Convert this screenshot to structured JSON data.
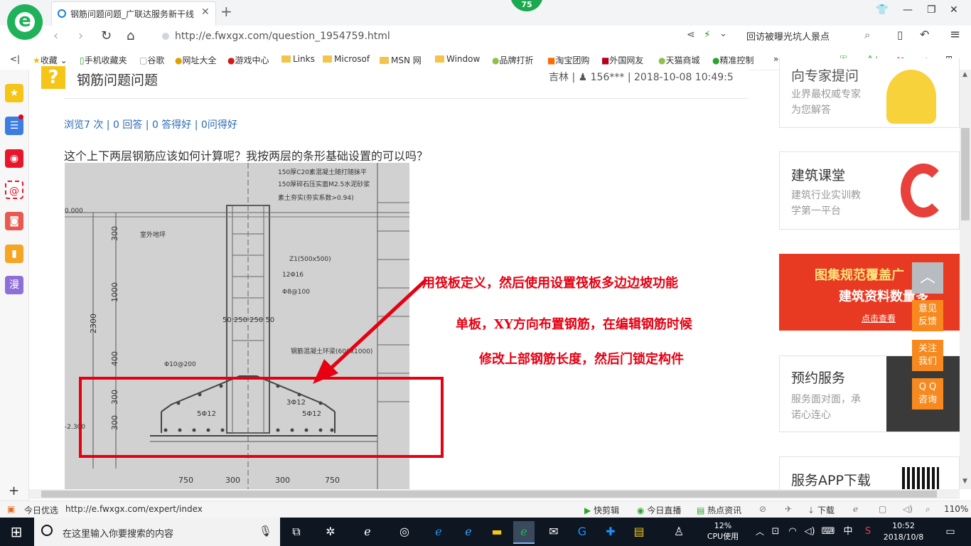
{
  "browser": {
    "tab_title": "钢筋问题问题_广联达服务新干线",
    "badge": "75",
    "url": "http://e.fwxgx.com/question_1954759.html",
    "search_text": "回访被曝光坑人景点"
  },
  "bookmarks": [
    "收藏",
    "手机收藏夹",
    "谷歌",
    "网址大全",
    "游戏中心",
    "Links",
    "Microsof",
    "MSN 网",
    "Window",
    "品牌打折",
    "淘宝团购",
    "外国网友",
    "天猫商城",
    "精准控制"
  ],
  "question": {
    "title": "钢筋问题问题",
    "author": "吉林",
    "user": "156***",
    "datetime": "2018-10-08 10:49:5",
    "stats": "浏览7 次 | 0 回答 | 0 答得好 | 0问得好",
    "text": "这个上下两层钢筋应该如何计算呢？我按两层的条形基础设置的可以吗？"
  },
  "annotation": {
    "line1": "用筏板定义，然后使用设置筏板多边边坡功能",
    "line2": "单板，XY方向布置钢筋，在编辑钢筋时候",
    "line3": "修改上部钢筋长度，然后门锁定构件"
  },
  "photo_labels": {
    "l1": "150厚C20素混凝土随打随抹平",
    "l2": "150厚碎石压实面M2.5水泥砂浆",
    "l3": "素土夯实(夯实系数>0.94)",
    "zi": "Z1(500x500)",
    "r1": "12Φ16",
    "r2": "Φ8@100",
    "d1": "50 250 250 50",
    "d2": "Φ10@200",
    "d3": "钢筋混凝土环梁(600x1000)",
    "b1": "5Φ12",
    "b2": "3Φ12",
    "b3": "5Φ12",
    "y1": "300",
    "y2": "1000",
    "y3": "2300",
    "y4": "400",
    "y5": "300",
    "y6": "300",
    "x1": "750",
    "x2": "300",
    "x3": "300",
    "x4": "750",
    "lvl": "-2.300",
    "top": "0.000",
    "room": "室外地坪"
  },
  "sidebar_right": {
    "card1_title": "向专家提问",
    "card1_sub1": "业界最权威专家",
    "card1_sub2": "为您解答",
    "card2_title": "建筑课堂",
    "card2_sub1": "建筑行业实训教",
    "card2_sub2": "学第一平台",
    "banner_line1": "图集规范覆盖广",
    "banner_line2": "建筑资料数量多",
    "banner_btn": "点击查看",
    "card3_title": "预约服务",
    "card3_sub1": "服务面对面，承",
    "card3_sub2": "诺心连心",
    "card4_title": "服务APP下载",
    "float1a": "意见",
    "float1b": "反馈",
    "float2a": "关注",
    "float2b": "我们",
    "float3a": "Q Q",
    "float3b": "咨询"
  },
  "status": {
    "left_label": "今日优选",
    "hover_url": "http://e.fwxgx.com/expert/index",
    "r1": "快剪辑",
    "r2": "今日直播",
    "r3": "热点资讯",
    "r4": "下载",
    "zoom": "110%"
  },
  "taskbar": {
    "search_placeholder": "在这里输入你要搜索的内容",
    "cpu_value": "12%",
    "cpu_label": "CPU使用",
    "ime": "中",
    "time": "10:52",
    "date": "2018/10/8"
  }
}
